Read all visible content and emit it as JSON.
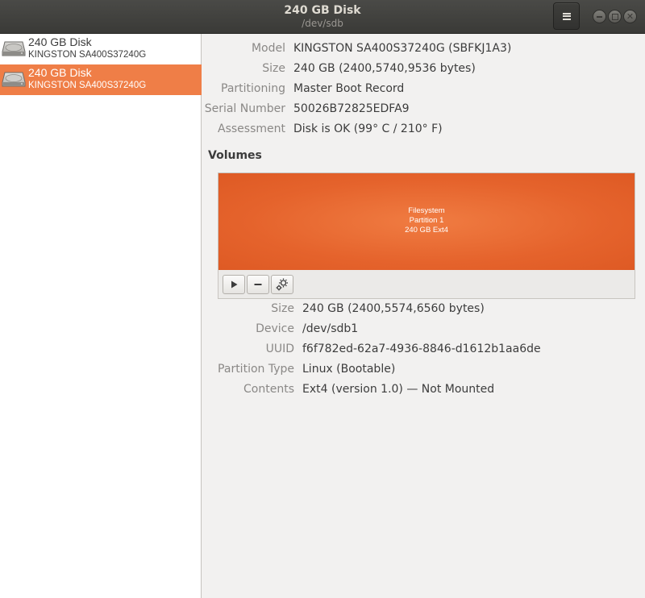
{
  "window": {
    "title": "240 GB Disk",
    "subtitle": "/dev/sdb"
  },
  "sidebar": {
    "items": [
      {
        "name": "240 GB Disk",
        "model": "KINGSTON SA400S37240G",
        "selected": false
      },
      {
        "name": "240 GB Disk",
        "model": "KINGSTON SA400S37240G",
        "selected": true
      }
    ]
  },
  "drive": {
    "model_label": "Model",
    "model_value": "KINGSTON SA400S37240G (SBFKJ1A3)",
    "size_label": "Size",
    "size_value": "240 GB (2400,5740,9536 bytes)",
    "partitioning_label": "Partitioning",
    "partitioning_value": "Master Boot Record",
    "serial_label": "Serial Number",
    "serial_value": "50026B72825EDFA9",
    "assessment_label": "Assessment",
    "assessment_value": "Disk is OK (99° C / 210° F)"
  },
  "volumes": {
    "heading": "Volumes",
    "partition": {
      "line1": "Filesystem",
      "line2": "Partition 1",
      "line3": "240 GB Ext4"
    },
    "toolbar": {
      "mount_icon": "play-icon",
      "delete_icon": "minus-icon",
      "options_icon": "gears-icon"
    }
  },
  "volume_details": {
    "size_label": "Size",
    "size_value": "240 GB (2400,5574,6560 bytes)",
    "device_label": "Device",
    "device_value": "/dev/sdb1",
    "uuid_label": "UUID",
    "uuid_value": "f6f782ed-62a7-4936-8846-d1612b1aa6de",
    "ptype_label": "Partition Type",
    "ptype_value": "Linux (Bootable)",
    "contents_label": "Contents",
    "contents_value": "Ext4 (version 1.0) — Not Mounted"
  },
  "colors": {
    "accent": "#ef7e47",
    "partition": "#e5632c",
    "titlebar": "#3f3f3c"
  }
}
